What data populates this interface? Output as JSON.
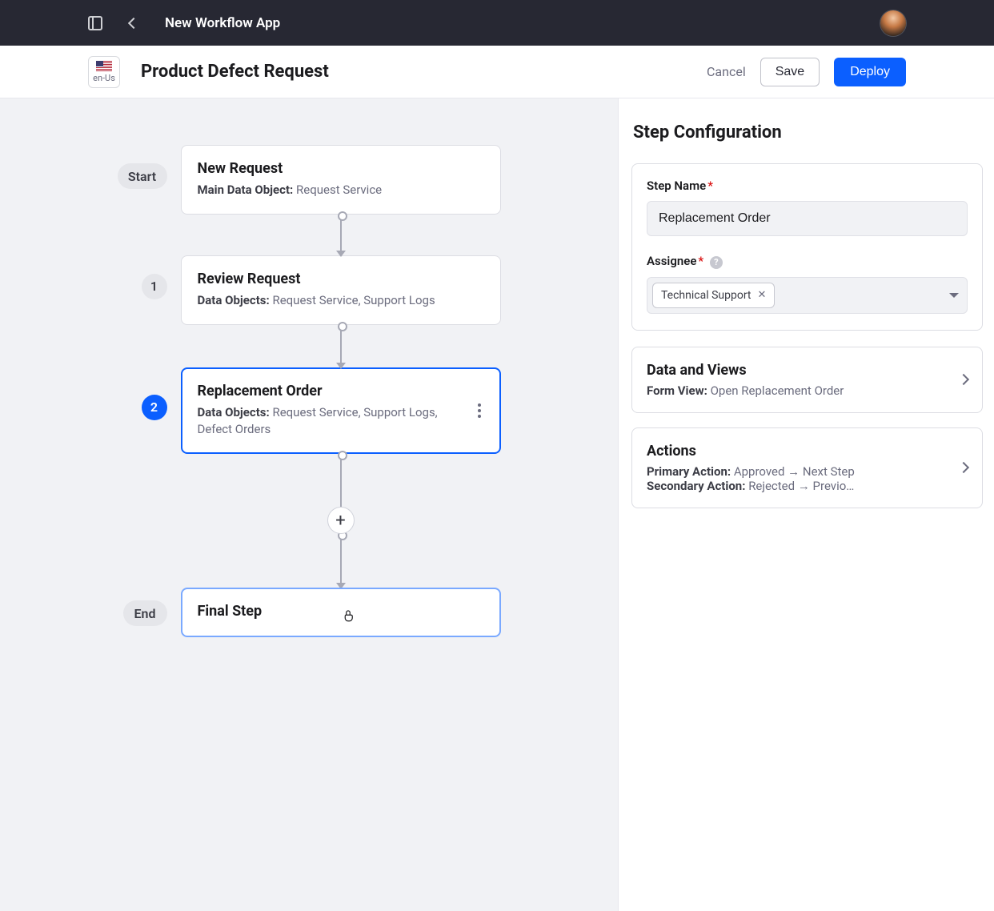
{
  "header": {
    "app_title": "New Workflow App"
  },
  "subheader": {
    "locale_label": "en-Us",
    "page_title": "Product Defect Request",
    "cancel_label": "Cancel",
    "save_label": "Save",
    "deploy_label": "Deploy"
  },
  "workflow": {
    "start_label": "Start",
    "end_label": "End",
    "step1_num": "1",
    "step2_num": "2",
    "start_card": {
      "title": "New Request",
      "sub_label": "Main Data Object:",
      "sub_value": "Request Service"
    },
    "step1_card": {
      "title": "Review Request",
      "sub_label": "Data Objects:",
      "sub_value": "Request Service, Support Logs"
    },
    "step2_card": {
      "title": "Replacement Order",
      "sub_label": "Data Objects:",
      "sub_value": "Request Service, Support Logs, Defect Orders"
    },
    "end_card": {
      "title": "Final Step"
    },
    "add_symbol": "+"
  },
  "sidepanel": {
    "title": "Step Configuration",
    "step_name": {
      "label": "Step Name",
      "value": "Replacement Order"
    },
    "assignee": {
      "label": "Assignee",
      "chip_value": "Technical Support"
    },
    "data_views": {
      "title": "Data and Views",
      "sub_label": "Form View:",
      "sub_value": "Open Replacement Order"
    },
    "actions": {
      "title": "Actions",
      "primary_label": "Primary Action:",
      "primary_value": "Approved → Next Step",
      "secondary_label": "Secondary Action:",
      "secondary_value": "Rejected → Previo…"
    }
  }
}
